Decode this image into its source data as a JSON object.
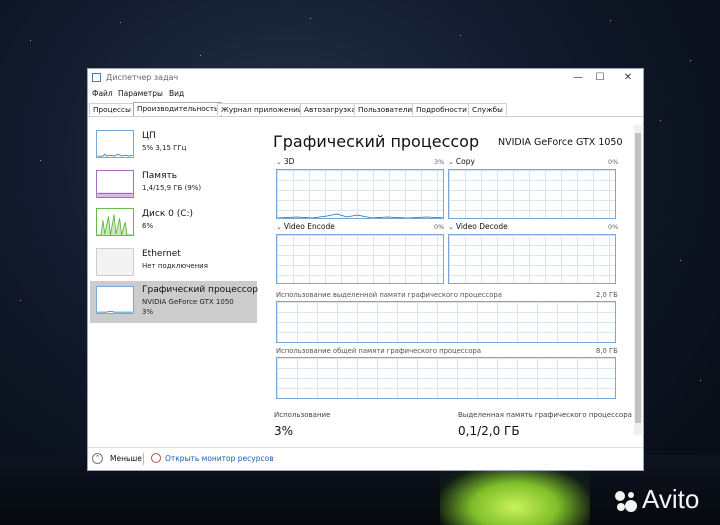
{
  "window": {
    "title": "Диспетчер задач",
    "controls": [
      "—",
      "☐",
      "✕"
    ]
  },
  "menu": {
    "file": "Файл",
    "params": "Параметры",
    "view": "Вид"
  },
  "tabs": [
    "Процессы",
    "Производительность",
    "Журнал приложений",
    "Автозагрузка",
    "Пользователи",
    "Подробности",
    "Службы"
  ],
  "active_tab": "Производительность",
  "sidebar": {
    "items": [
      {
        "title": "ЦП",
        "sub": "5% 3,15 ГГц"
      },
      {
        "title": "Память",
        "sub": "1,4/15,9 ГБ (9%)"
      },
      {
        "title": "Диск 0 (C:)",
        "sub": "6%"
      },
      {
        "title": "Ethernet",
        "sub": "Нет подключения"
      },
      {
        "title": "Графический процессор",
        "sub": "NVIDIA GeForce GTX 1050",
        "sub2": "3%"
      }
    ]
  },
  "main": {
    "title": "Графический процессор",
    "gpu_name": "NVIDIA GeForce GTX 1050",
    "graphs": [
      {
        "label": "3D",
        "pct": "3%"
      },
      {
        "label": "Copy",
        "pct": "0%"
      },
      {
        "label": "Video Encode",
        "pct": "0%"
      },
      {
        "label": "Video Decode",
        "pct": "0%"
      }
    ],
    "dedicated_mem_label": "Использование выделенной памяти графического процессора",
    "dedicated_mem_max": "2,0 ГБ",
    "shared_mem_label": "Использование общей памяти графического процессора",
    "shared_mem_max": "8,0 ГБ",
    "usage_label": "Использование",
    "usage_value": "3%",
    "dedicated_label": "Выделенная память графического процессора",
    "dedicated_value": "0,1/2,0 ГБ"
  },
  "footer": {
    "less": "Меньше",
    "resmon": "Открыть монитор ресурсов"
  },
  "watermark": {
    "text": "Avito"
  },
  "colors": {
    "cpu": "#1172b4",
    "memory": "#8b2ba8",
    "disk": "#4caf24",
    "gpu": "#1172b4"
  }
}
